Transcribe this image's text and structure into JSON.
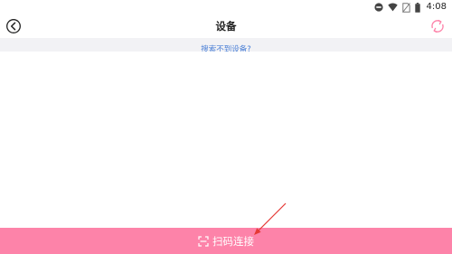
{
  "status_bar": {
    "time": "4:08",
    "icons": [
      "do-not-disturb-icon",
      "wifi-icon",
      "no-sim-icon",
      "battery-icon"
    ]
  },
  "header": {
    "title": "设备",
    "back_icon": "back-circle-icon",
    "refresh_icon": "refresh-icon"
  },
  "hint": {
    "text": "搜索不到设备?"
  },
  "scan_button": {
    "label": "扫码连接",
    "icon": "scan-icon"
  },
  "colors": {
    "accent": "#fd83a9",
    "link": "#4a7fd6",
    "hint_bg": "#f2f2f5",
    "annotation": "#e53935"
  }
}
